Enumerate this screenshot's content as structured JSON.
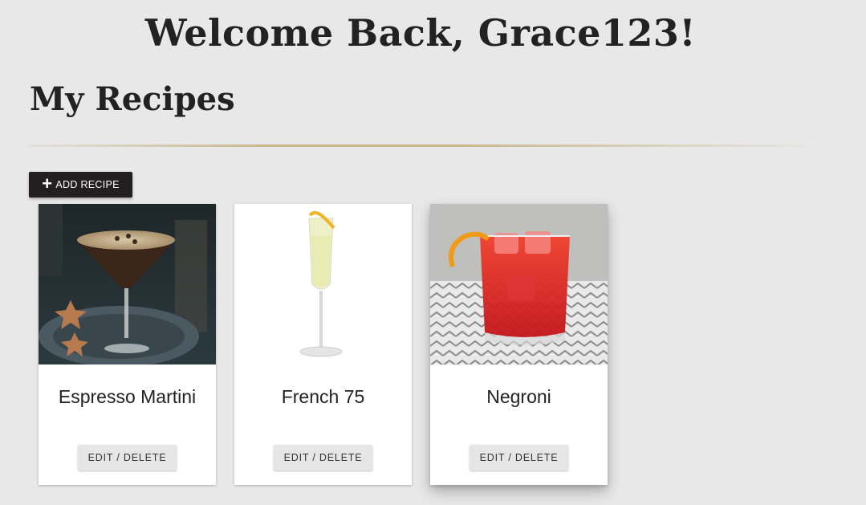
{
  "header": {
    "welcome": "Welcome Back, Grace123!"
  },
  "section": {
    "title": "My Recipes"
  },
  "toolbar": {
    "add_label": "ADD RECIPE"
  },
  "recipes": [
    {
      "name": "Espresso Martini",
      "action_label": "EDIT / DELETE"
    },
    {
      "name": "French 75",
      "action_label": "EDIT / DELETE"
    },
    {
      "name": "Negroni",
      "action_label": "EDIT / DELETE"
    }
  ],
  "colors": {
    "background": "#e8e8e8",
    "button_dark": "#231f20",
    "divider_gold": "#c9b88d"
  }
}
